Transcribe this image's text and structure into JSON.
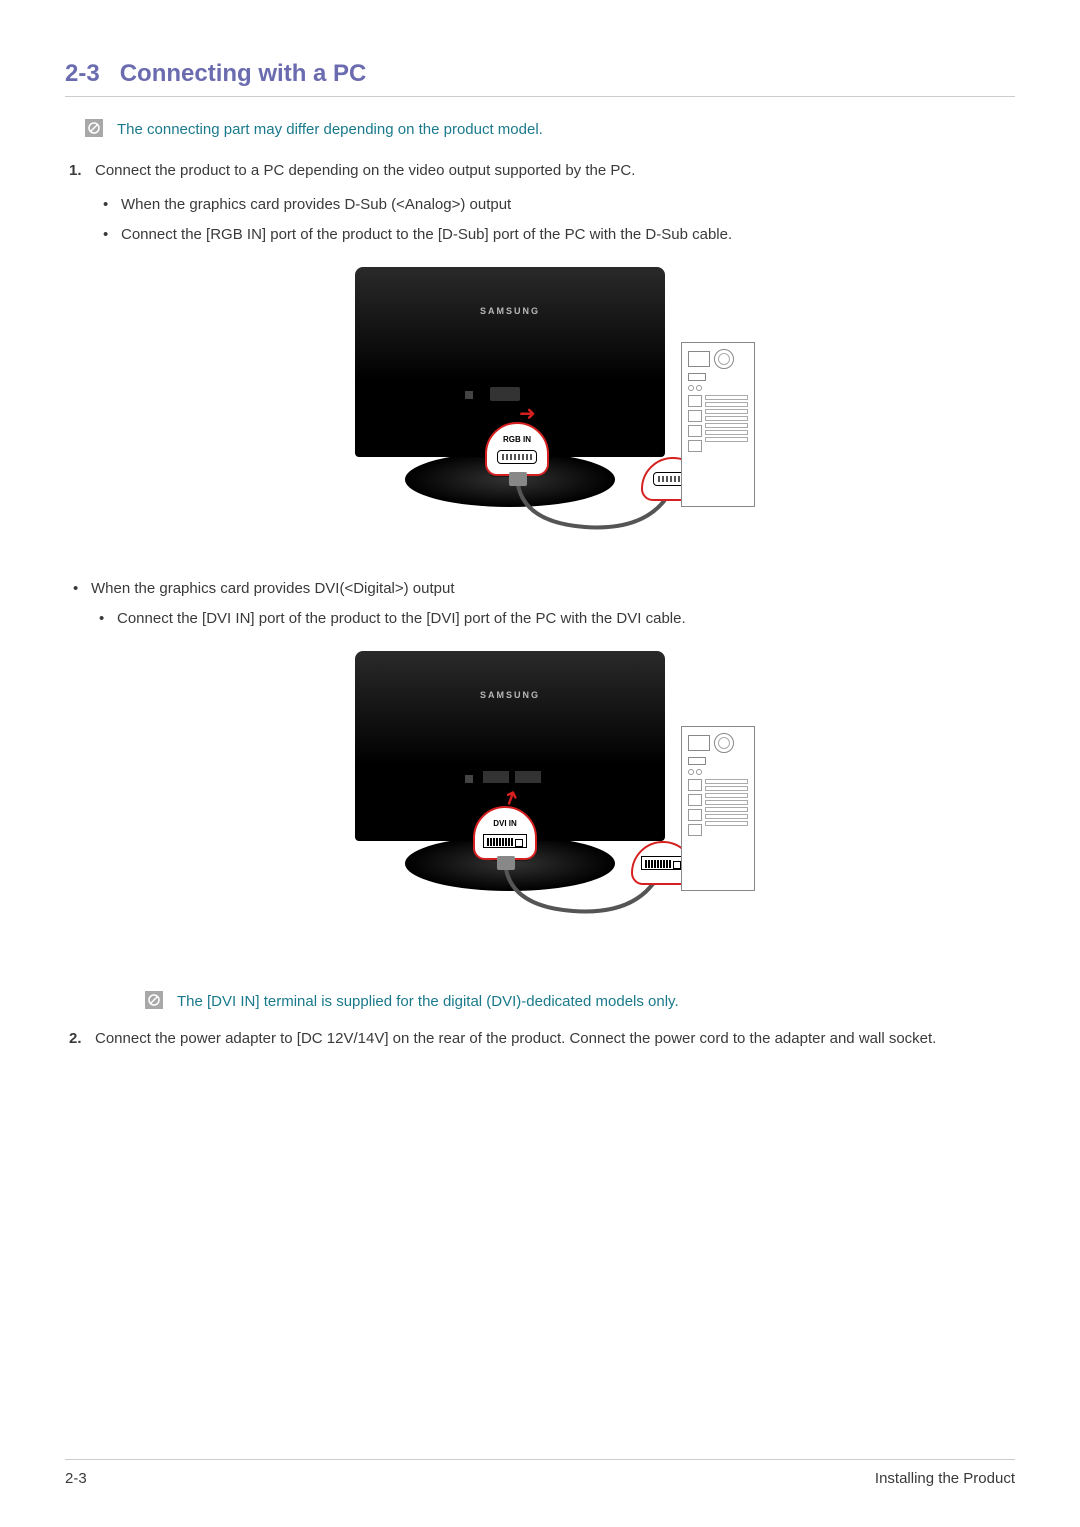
{
  "section": {
    "number": "2-3",
    "title": "Connecting with a PC"
  },
  "notes": {
    "top": "The connecting part may differ depending on the product model.",
    "dvi": "The [DVI IN] terminal is supplied for the digital (DVI)-dedicated models only."
  },
  "steps": {
    "step1": "Connect the product to a PC depending on the video output supported by the PC.",
    "step1a": "When the graphics card provides D-Sub (<Analog>) output",
    "step1a_sub": "Connect the [RGB IN] port of the product to the [D-Sub] port of the PC with the D-Sub cable.",
    "step1b": "When the graphics card provides DVI(<Digital>) output",
    "step1b_sub": "Connect the [DVI IN] port of the product to the [DVI] port of the PC with the DVI cable.",
    "step2": "Connect the power adapter to [DC 12V/14V] on the rear of the product. Connect the power cord to the adapter and wall socket."
  },
  "labels": {
    "brand": "SAMSUNG",
    "rgb_port": "RGB IN",
    "dvi_port": "DVI IN"
  },
  "footer": {
    "page": "2-3",
    "chapter": "Installing the Product"
  }
}
